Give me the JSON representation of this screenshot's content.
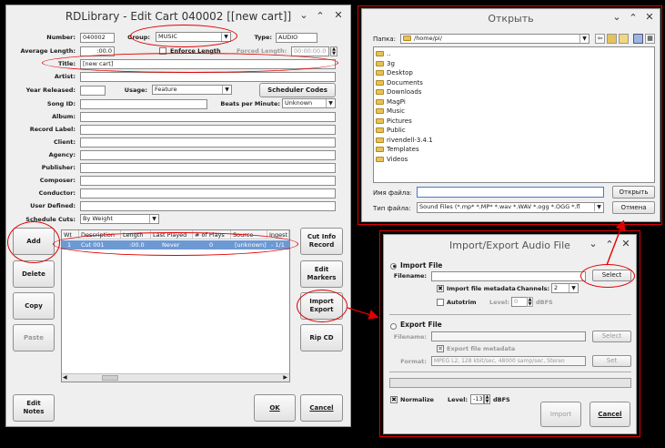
{
  "colors": {
    "accent_red": "#e00000",
    "selection": "#6d99d3",
    "window_bg": "#efefef"
  },
  "main": {
    "title": "RDLibrary - Edit Cart 040002 [[new cart]]",
    "labels": {
      "number": "Number:",
      "group": "Group:",
      "type": "Type:",
      "avg_length": "Average Length:",
      "enforce": "Enforce Length",
      "forced": "Forced Length:",
      "title": "Title:",
      "artist": "Artist:",
      "year": "Year Released:",
      "usage": "Usage:",
      "song_id": "Song ID:",
      "bpm": "Beats per Minute:",
      "album": "Album:",
      "record_label": "Record Label:",
      "client": "Client:",
      "agency": "Agency:",
      "publisher": "Publisher:",
      "composer": "Composer:",
      "conductor": "Conductor:",
      "user_defined": "User Defined:",
      "schedule_cuts": "Schedule Cuts:"
    },
    "values": {
      "number": "040002",
      "group": "MUSIC",
      "type": "AUDIO",
      "avg_length": ":00.0",
      "forced": "00:00:00.0",
      "title": "[new cart]",
      "artist": "",
      "year": "",
      "usage": "Feature",
      "song_id": "",
      "bpm": "Unknown",
      "schedule_cuts": "By Weight"
    },
    "buttons": {
      "scheduler_codes": "Scheduler Codes",
      "add": "Add",
      "delete": "Delete",
      "copy": "Copy",
      "paste": "Paste",
      "edit_notes": "Edit\nNotes",
      "cut_info": "Cut Info\nRecord",
      "edit_markers": "Edit\nMarkers",
      "import_export": "Import\nExport",
      "rip_cd": "Rip CD",
      "ok": "OK",
      "cancel": "Cancel"
    },
    "cuts_table": {
      "headers": [
        "Wt",
        "Description",
        "Length",
        "Last Played",
        "# of Plays",
        "Source",
        "Ingest"
      ],
      "rows": [
        [
          "1",
          "Cut 001",
          ":00.0",
          "Never",
          "0",
          "[unknown]",
          "- 1/1"
        ]
      ]
    }
  },
  "open_dialog": {
    "title": "Открыть",
    "folder_label": "Папка:",
    "folder_path": "/home/pi/",
    "entries": [
      "..",
      "3g",
      "Desktop",
      "Documents",
      "Downloads",
      "MagPi",
      "Music",
      "Pictures",
      "Public",
      "rivendell-3.4.1",
      "Templates",
      "Videos"
    ],
    "filename_label": "Имя файла:",
    "filename_value": "",
    "filetype_label": "Тип файла:",
    "filetype_value": "Sound Files (*.mp* *.MP* *.wav *.WAV *.ogg *.OGG *.fl",
    "open_button": "Открыть",
    "cancel_button": "Отмена"
  },
  "import_dialog": {
    "title": "Import/Export Audio File",
    "import_section": "Import File",
    "filename_label": "Filename:",
    "import_filename": "",
    "select_button": "Select",
    "import_metadata": "Import file metadata",
    "channels_label": "Channels:",
    "channels_value": "2",
    "autotrim": "Autotrim",
    "level_label": "Level:",
    "autotrim_level": "0",
    "dbfs": "dBFS",
    "export_section": "Export File",
    "export_filename_label": "Filename:",
    "export_filename": "",
    "export_select": "Select",
    "export_metadata": "Export file metadata",
    "format_label": "Format:",
    "format_value": "MPEG L2, 128 kbit/sec, 48000 samp/sec, Stereo",
    "set_button": "Set",
    "normalize": "Normalize",
    "normalize_level_label": "Level:",
    "normalize_level": "-13",
    "import_button": "Import",
    "cancel_button": "Cancel"
  }
}
